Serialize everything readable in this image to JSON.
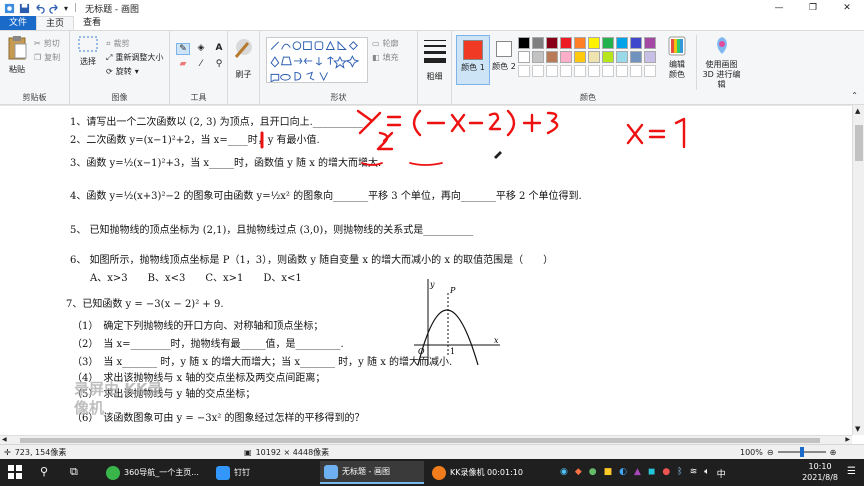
{
  "window": {
    "title": "无标题 - 画图",
    "buttons": [
      "—",
      "❐",
      "✕"
    ]
  },
  "tabs": [
    {
      "label": "文件"
    },
    {
      "label": "主页"
    },
    {
      "label": "查看"
    }
  ],
  "ribbon": {
    "clipboard": {
      "paste": "粘贴",
      "cut": "剪切",
      "copy": "复制",
      "label": "剪贴板"
    },
    "image": {
      "select": "选择",
      "crop": "裁剪",
      "resize": "重新调整大小",
      "rotate": "旋转",
      "label": "图像"
    },
    "tools": {
      "label": "工具"
    },
    "brushes": {
      "label": "刷子"
    },
    "shapes": {
      "outline": "轮廓",
      "fill": "填充",
      "label": "形状"
    },
    "size": {
      "label": "粗细"
    },
    "color1": {
      "label": "颜色 1",
      "value": "#f03a24"
    },
    "color2": {
      "label": "颜色 2",
      "value": "#ffffff"
    },
    "colors": {
      "label": "颜色"
    },
    "edit_colors": {
      "label": "编辑颜色"
    },
    "paint3d": {
      "label": "使用画图 3D 进行编辑"
    },
    "palette_row1": [
      "#000000",
      "#7f7f7f",
      "#880015",
      "#ed1c24",
      "#ff7f27",
      "#fff200",
      "#22b14c",
      "#00a2e8",
      "#3f48cc",
      "#a349a4"
    ],
    "palette_row2": [
      "#ffffff",
      "#c3c3c3",
      "#b97a57",
      "#ffaec9",
      "#ffc90e",
      "#efe4b0",
      "#b5e61d",
      "#99d9ea",
      "#7092be",
      "#c8bfe7"
    ]
  },
  "document": {
    "lines": [
      "1、请写出一个二次函数以 (2, 3) 为顶点，且开口向上.__________",
      "2、二次函数 y=(x−1)²+2，当 x=____时，y 有最小值.",
      "3、函数 y=½(x−1)²+3，当 x_____时，函数值 y 随 x 的增大而增大.",
      "4、函数 y=½(x+3)²−2 的图象可由函数 y=½x² 的图象向_______平移 3 个单位，再向_______平移 2 个单位得到.",
      "5、 已知抛物线的顶点坐标为 (2,1)，且抛物线过点 (3,0)，则抛物线的关系式是__________",
      "6、 如图所示，抛物线顶点坐标是 P（1，3），则函数 y 随自变量 x 的增大而减小的 x 的取值范围是（　　）",
      "A、x>3　　B、x<3　　C、x>1　　D、x<1",
      "7、已知函数 y = −3(x − 2)² + 9.",
      "（1）　确定下列抛物线的开口方向、对称轴和顶点坐标；",
      "（2）　当 x=________时，抛物线有最_____值，是_________.",
      "（3）　当 x_______ 时，y 随 x 的增大而增大；当 x_______ 时，y 随 x 的增大而减小.",
      "（4）　求出该抛物线与 x 轴的交点坐标及两交点间距离；",
      "（5）　求出该抛物线与 y 轴的交点坐标；",
      "（6）　该函数图象可由 y = −3x² 的图象经过怎样的平移得到的？"
    ],
    "graph_labels": {
      "y": "y",
      "x": "x",
      "p": "P",
      "o": "O",
      "one": "1"
    },
    "handwriting": {
      "line1": "y=(x−2)²+3",
      "side": "x=1"
    },
    "watermark": "录屏由 KK录像机"
  },
  "status": {
    "cursor": "723, 154像素",
    "size": "10192 × 4448像素",
    "zoom": "100%"
  },
  "taskbar": {
    "apps": [
      {
        "label": "360导航_一个主页..."
      },
      {
        "label": "钉钉"
      },
      {
        "label": "无标题 - 画图"
      },
      {
        "label": "KK录像机 00:01:10"
      }
    ],
    "time": "10:10",
    "date": "2021/8/8"
  }
}
